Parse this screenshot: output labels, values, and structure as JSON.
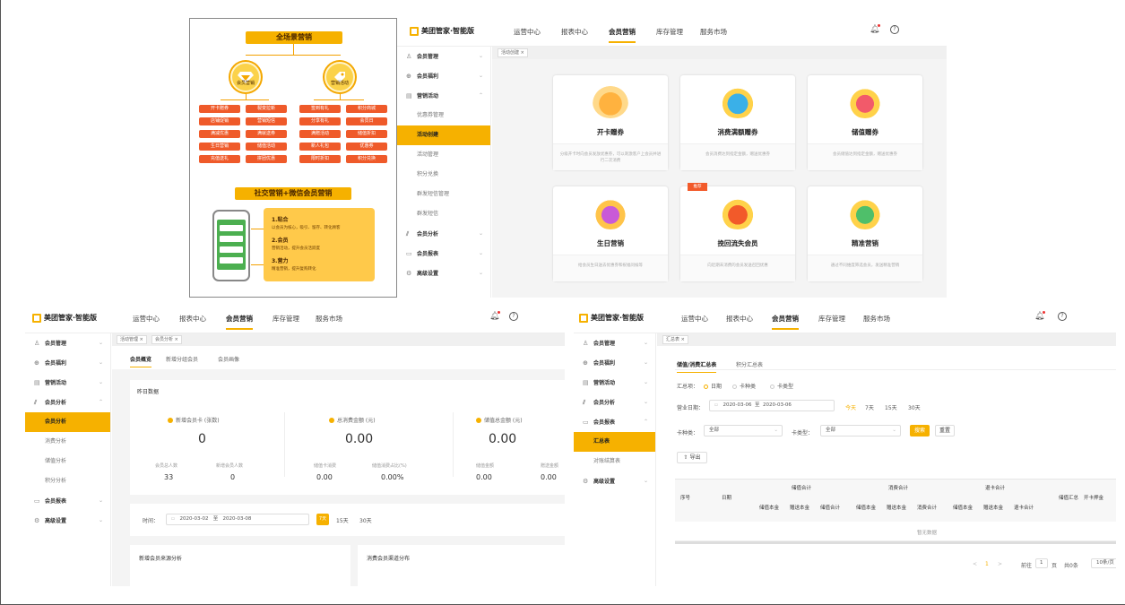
{
  "poster": {
    "title": "全场景营销",
    "left_circle_label": "会员营销",
    "right_circle_label": "营销活动",
    "chips_left": [
      "开卡赠券",
      "裂变拉新",
      "店铺促销",
      "营销短信",
      "满减优惠",
      "满就送券",
      "生日营销",
      "储值活动",
      "充值送礼",
      "拼团优惠"
    ],
    "chips_right": [
      "签到有礼",
      "积分商城",
      "分享有礼",
      "会员日",
      "满赠活动",
      "储值折扣",
      "新人礼包",
      "优惠券",
      "限时折扣",
      "积分兑换"
    ],
    "section2_title": "社交营销+微信会员营销",
    "points": [
      {
        "title": "1.粘合",
        "desc": "以会员为核心，吸引、留存、转化顾客"
      },
      {
        "title": "2.会员",
        "desc": "营销活动，提升会员活跃度"
      },
      {
        "title": "3.营力",
        "desc": "精准营销，提升复购转化"
      }
    ]
  },
  "app": {
    "logo": "美团管家·智能版",
    "nav": [
      "运营中心",
      "报表中心",
      "会员营销",
      "库存管理",
      "服务市场"
    ],
    "active_nav": "会员营销"
  },
  "panel1": {
    "sidebar": [
      {
        "label": "会员管理",
        "icon": "user-icon",
        "type": "group-collapsed"
      },
      {
        "label": "会员福利",
        "icon": "gift-icon",
        "type": "group-collapsed"
      },
      {
        "label": "营销活动",
        "icon": "calendar-icon",
        "type": "group-open"
      },
      {
        "label": "优惠券管理",
        "type": "sub"
      },
      {
        "label": "活动创建",
        "type": "sub-active"
      },
      {
        "label": "活动管理",
        "type": "sub"
      },
      {
        "label": "积分兑换",
        "type": "sub"
      },
      {
        "label": "群发短信管理",
        "type": "sub"
      },
      {
        "label": "群发短信",
        "type": "sub"
      },
      {
        "label": "会员分析",
        "icon": "chart-icon",
        "type": "group-collapsed"
      },
      {
        "label": "会员报表",
        "icon": "report-icon",
        "type": "group-collapsed"
      },
      {
        "label": "高级设置",
        "icon": "gear-icon",
        "type": "group-collapsed"
      }
    ],
    "tab": "活动创建 ×",
    "cards": [
      {
        "title": "开卡赠券",
        "desc": "分级开卡时向会员发放优惠券，可以刺激客户上会员并进行二次消费"
      },
      {
        "title": "消费满额赠券",
        "desc": "会员消费达到指定金额，赠送优惠券"
      },
      {
        "title": "储值赠券",
        "desc": "会员储值达到指定金额，赠送优惠券"
      },
      {
        "title": "生日营销",
        "desc": "给会员生日送去优惠券和祝福问候等"
      },
      {
        "title": "挽回流失会员",
        "desc": "向近期未消费的会员发送召回优惠",
        "tag": "推荐"
      },
      {
        "title": "精准营销",
        "desc": "通过不同维度筛选会员，发送精准营销"
      }
    ]
  },
  "panel2": {
    "sidebar": [
      {
        "label": "会员管理",
        "icon": "user-icon",
        "type": "group-collapsed"
      },
      {
        "label": "会员福利",
        "icon": "gift-icon",
        "type": "group-collapsed"
      },
      {
        "label": "营销活动",
        "icon": "calendar-icon",
        "type": "group-collapsed"
      },
      {
        "label": "会员分析",
        "icon": "chart-icon",
        "type": "group-open"
      },
      {
        "label": "会员分析",
        "type": "sub-active"
      },
      {
        "label": "消费分析",
        "type": "sub"
      },
      {
        "label": "储值分析",
        "type": "sub"
      },
      {
        "label": "积分分析",
        "type": "sub"
      },
      {
        "label": "会员报表",
        "icon": "report-icon",
        "type": "group-collapsed"
      },
      {
        "label": "高级设置",
        "icon": "gear-icon",
        "type": "group-collapsed"
      }
    ],
    "tabs": [
      "活动管理 ×",
      "会员分析 ×"
    ],
    "subtabs": [
      "会员概览",
      "新增分组会员",
      "会员画像"
    ],
    "section_title": "昨日数据",
    "stats": [
      {
        "label": "新增会员卡 (张数)",
        "value": "0",
        "subs": [
          {
            "label": "会员总人数",
            "value": "33"
          },
          {
            "label": "新增会员人数",
            "value": "0"
          }
        ]
      },
      {
        "label": "总消费金额 (元)",
        "value": "0.00",
        "subs": [
          {
            "label": "储值卡消费",
            "value": "0.00"
          },
          {
            "label": "储值消费占比(%)",
            "value": "0.00%"
          }
        ]
      },
      {
        "label": "储值总金额 (元)",
        "value": "0.00",
        "subs": [
          {
            "label": "储值金额",
            "value": "0.00"
          },
          {
            "label": "赠送金额",
            "value": "0.00"
          }
        ]
      }
    ],
    "filter": {
      "label": "时间：",
      "start": "2020-03-02",
      "to": "至",
      "end": "2020-03-08",
      "quick": [
        "7天",
        "15天",
        "30天"
      ]
    },
    "bottom_left_title": "新增会员来源分析",
    "bottom_right_title": "消费会员渠道分布"
  },
  "panel3": {
    "sidebar": [
      {
        "label": "会员管理",
        "icon": "user-icon",
        "type": "group-collapsed"
      },
      {
        "label": "会员福利",
        "icon": "gift-icon",
        "type": "group-collapsed"
      },
      {
        "label": "营销活动",
        "icon": "calendar-icon",
        "type": "group-collapsed"
      },
      {
        "label": "会员分析",
        "icon": "chart-icon",
        "type": "group-collapsed"
      },
      {
        "label": "会员报表",
        "icon": "report-icon",
        "type": "group-open"
      },
      {
        "label": "汇总表",
        "type": "sub-active"
      },
      {
        "label": "对账结算表",
        "type": "sub"
      },
      {
        "label": "高级设置",
        "icon": "gear-icon",
        "type": "group-collapsed"
      }
    ],
    "tab": "汇总表 ×",
    "subtabs": [
      "储值/消费汇总表",
      "积分汇总表"
    ],
    "summary_label": "汇总项：",
    "summary_options": [
      "日期",
      "卡种类",
      "卡类型"
    ],
    "date_label": "营业日期：",
    "date_start": "2020-03-06",
    "date_to": "至",
    "date_end": "2020-03-06",
    "quick": [
      "今天",
      "7天",
      "15天",
      "30天"
    ],
    "card_kind_label": "卡种类：",
    "card_kind_value": "全部",
    "card_type_label": "卡类型：",
    "card_type_value": "全部",
    "search_btn": "搜索",
    "reset_btn": "重置",
    "export_btn": "导出",
    "table": {
      "col_no": "序号",
      "col_date": "日期",
      "groups": [
        "储值合计",
        "消费合计",
        "退卡合计"
      ],
      "group_subs": [
        [
          "储值本金",
          "赠送本金",
          "储值合计"
        ],
        [
          "储值本金",
          "赠送本金",
          "消费合计"
        ],
        [
          "储值本金",
          "赠送本金",
          "退卡合计"
        ]
      ],
      "col_summary": "储值汇总",
      "col_open": "开卡押金",
      "empty": "暂无数据"
    },
    "pagination": {
      "prev": "<",
      "page": "1",
      "next": ">",
      "goto": "前往",
      "goto_page": "1",
      "page_unit": "页",
      "total": "共0条",
      "size": "10条/页"
    }
  }
}
